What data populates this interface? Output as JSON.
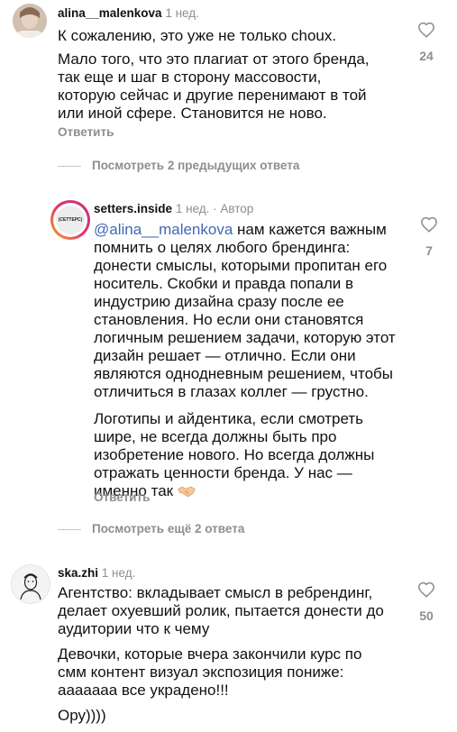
{
  "comments": [
    {
      "username": "alina__malenkova",
      "time": "1 нед.",
      "paragraphs": [
        "К сожалению, это уже не только choux.",
        "Мало того, что это плагиат от этого бренда, так еще и шаг в сторону массовости, которую сейчас и другие перенимают в той или иной сфере. Становится не ново."
      ],
      "reply_label": "Ответить",
      "likes": "24"
    },
    {
      "username": "setters.inside",
      "time": "1 нед.",
      "author_badge": "· Автор",
      "avatar_text": "(СЕТТЕРС)",
      "mention": "@alina__malenkova",
      "paragraph1_rest": " нам кажется важным помнить о целях любого брендинга: донести смыслы, которыми пропитан его носитель. Скобки и правда попали в индустрию дизайна сразу после ее становления. Но если они становятся логичным решением задачи, которую этот дизайн решает — отлично. Если они являются однодневным решением, чтобы отличиться в глазах коллег — грустно.",
      "paragraph2": "Логотипы и айдентика, если смотреть шире, не всегда должны быть про изобретение нового. Но всегда должны отражать ценности бренда. У нас — именно так",
      "emoji_icon": "handshake-icon",
      "reply_label": "Ответить",
      "likes": "7"
    },
    {
      "username": "ska.zhi",
      "time": "1 нед.",
      "paragraphs": [
        "Агентство: вкладывает смысл в ребрендинг, делает охуевший ролик, пытается донести до аудитории что к чему",
        "Девочки, которые вчера закончили курс по смм контент визуал экспозиция пониже: ааааааа все украдено!!!",
        "Ору))))"
      ],
      "likes": "50"
    }
  ],
  "view_more_1": "Посмотреть 2 предыдущих ответа",
  "view_more_2": "Посмотреть ещё 2 ответа",
  "icons": {
    "like": "heart-outline-icon"
  },
  "colors": {
    "mention": "#3f68b4",
    "secondary_text": "#8e8e8e",
    "story_ring_start": "#f9a825",
    "story_ring_end": "#d62976"
  }
}
